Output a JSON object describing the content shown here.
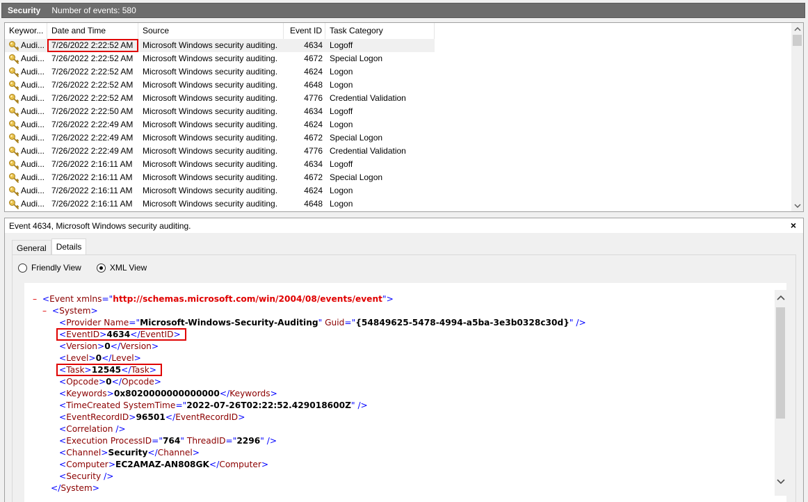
{
  "log": {
    "name": "Security",
    "count_label": "Number of events: 580"
  },
  "columns": {
    "keywords": "Keywor...",
    "date": "Date and Time",
    "source": "Source",
    "event_id": "Event ID",
    "task": "Task Category"
  },
  "events": [
    {
      "kw": "Audi...",
      "date": "7/26/2022 2:22:52 AM",
      "source": "Microsoft Windows security auditing.",
      "id": "4634",
      "task": "Logoff"
    },
    {
      "kw": "Audi...",
      "date": "7/26/2022 2:22:52 AM",
      "source": "Microsoft Windows security auditing.",
      "id": "4672",
      "task": "Special Logon"
    },
    {
      "kw": "Audi...",
      "date": "7/26/2022 2:22:52 AM",
      "source": "Microsoft Windows security auditing.",
      "id": "4624",
      "task": "Logon"
    },
    {
      "kw": "Audi...",
      "date": "7/26/2022 2:22:52 AM",
      "source": "Microsoft Windows security auditing.",
      "id": "4648",
      "task": "Logon"
    },
    {
      "kw": "Audi...",
      "date": "7/26/2022 2:22:52 AM",
      "source": "Microsoft Windows security auditing.",
      "id": "4776",
      "task": "Credential Validation"
    },
    {
      "kw": "Audi...",
      "date": "7/26/2022 2:22:50 AM",
      "source": "Microsoft Windows security auditing.",
      "id": "4634",
      "task": "Logoff"
    },
    {
      "kw": "Audi...",
      "date": "7/26/2022 2:22:49 AM",
      "source": "Microsoft Windows security auditing.",
      "id": "4624",
      "task": "Logon"
    },
    {
      "kw": "Audi...",
      "date": "7/26/2022 2:22:49 AM",
      "source": "Microsoft Windows security auditing.",
      "id": "4672",
      "task": "Special Logon"
    },
    {
      "kw": "Audi...",
      "date": "7/26/2022 2:22:49 AM",
      "source": "Microsoft Windows security auditing.",
      "id": "4776",
      "task": "Credential Validation"
    },
    {
      "kw": "Audi...",
      "date": "7/26/2022 2:16:11 AM",
      "source": "Microsoft Windows security auditing.",
      "id": "4634",
      "task": "Logoff"
    },
    {
      "kw": "Audi...",
      "date": "7/26/2022 2:16:11 AM",
      "source": "Microsoft Windows security auditing.",
      "id": "4672",
      "task": "Special Logon"
    },
    {
      "kw": "Audi...",
      "date": "7/26/2022 2:16:11 AM",
      "source": "Microsoft Windows security auditing.",
      "id": "4624",
      "task": "Logon"
    },
    {
      "kw": "Audi...",
      "date": "7/26/2022 2:16:11 AM",
      "source": "Microsoft Windows security auditing.",
      "id": "4648",
      "task": "Logon"
    }
  ],
  "detail": {
    "title": "Event 4634, Microsoft Windows security auditing.",
    "close": "×",
    "tabs": [
      "General",
      "Details"
    ],
    "view_friendly": "Friendly View",
    "view_xml": "XML View",
    "xml": {
      "event_tag": "Event",
      "xmlns_attr": "xmlns",
      "xmlns_val": "http://schemas.microsoft.com/win/2004/08/events/event",
      "system_tag": "System",
      "provider_tag": "Provider",
      "name_attr": "Name",
      "provider_name": "Microsoft-Windows-Security-Auditing",
      "guid_attr": "Guid",
      "provider_guid": "{54849625-5478-4994-a5ba-3e3b0328c30d}",
      "eventid_tag": "EventID",
      "eventid": "4634",
      "version_tag": "Version",
      "version": "0",
      "level_tag": "Level",
      "level": "0",
      "task_tag": "Task",
      "task": "12545",
      "opcode_tag": "Opcode",
      "opcode": "0",
      "keywords_tag": "Keywords",
      "keywords": "0x8020000000000000",
      "timecreated_tag": "TimeCreated",
      "systemtime_attr": "SystemTime",
      "systemtime": "2022-07-26T02:22:52.429018600Z",
      "recordid_tag": "EventRecordID",
      "recordid": "96501",
      "correlation_tag": "Correlation",
      "execution_tag": "Execution",
      "processid_attr": "ProcessID",
      "processid": "764",
      "threadid_attr": "ThreadID",
      "threadid": "2296",
      "channel_tag": "Channel",
      "channel": "Security",
      "computer_tag": "Computer",
      "computer": "EC2AMAZ-AN808GK",
      "security_tag": "Security"
    }
  },
  "colors": {
    "highlight": "#e00000",
    "tag": "#8b0000",
    "bracket": "#0000ff"
  }
}
